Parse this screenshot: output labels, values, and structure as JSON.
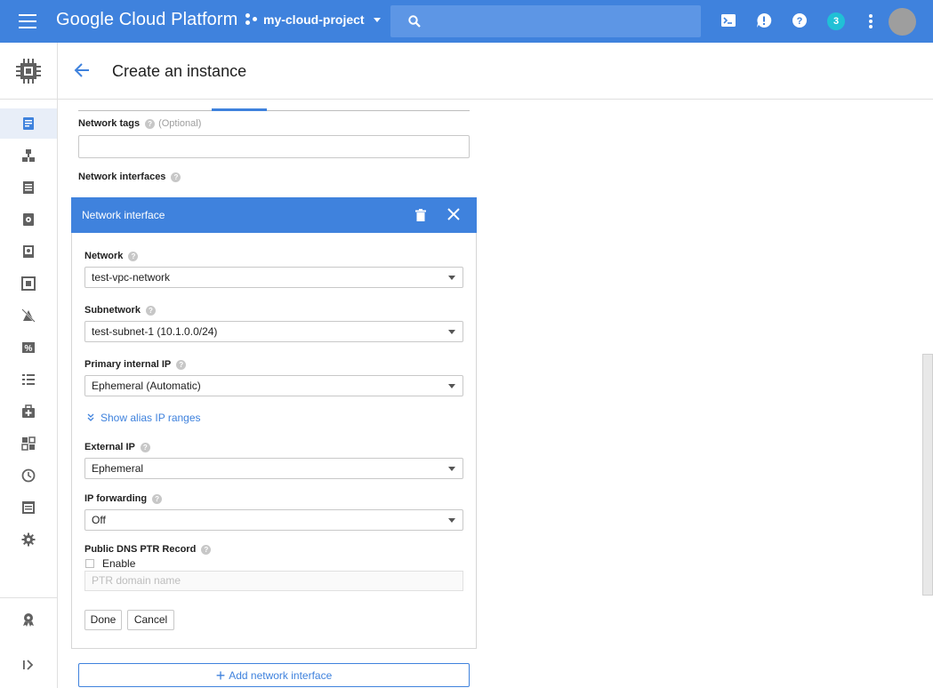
{
  "topbar": {
    "brand": "Google Cloud Platform",
    "project": "my-cloud-project",
    "notifications_count": "3",
    "color": "#3f82dd"
  },
  "sidebar": {
    "icons": [
      "compute-engine-icon",
      "vm-instances-icon",
      "instance-groups-icon",
      "instance-templates-icon",
      "disks-icon",
      "snapshots-icon",
      "images-icon",
      "tpus-icon",
      "committed-use-icon",
      "metadata-icon",
      "health-checks-icon",
      "zones-icon",
      "operations-icon",
      "quotas-icon",
      "settings-icon",
      "marketplace-icon",
      "expand-icon"
    ]
  },
  "header": {
    "title": "Create an instance"
  },
  "form": {
    "network_tags_label": "Network tags",
    "optional": "(Optional)",
    "network_tags_value": "",
    "network_interfaces_label": "Network interfaces"
  },
  "panel": {
    "title": "Network interface",
    "network_label": "Network",
    "network_value": "test-vpc-network",
    "subnetwork_label": "Subnetwork",
    "subnetwork_value": "test-subnet-1 (10.1.0.0/24)",
    "primary_ip_label": "Primary internal IP",
    "primary_ip_value": "Ephemeral (Automatic)",
    "alias_link": "Show alias IP ranges",
    "external_ip_label": "External IP",
    "external_ip_value": "Ephemeral",
    "ip_forwarding_label": "IP forwarding",
    "ip_forwarding_value": "Off",
    "ptr_label": "Public DNS PTR Record",
    "enable_label": "Enable",
    "ptr_placeholder": "PTR domain name",
    "done": "Done",
    "cancel": "Cancel"
  },
  "add_interface": "Add network interface"
}
